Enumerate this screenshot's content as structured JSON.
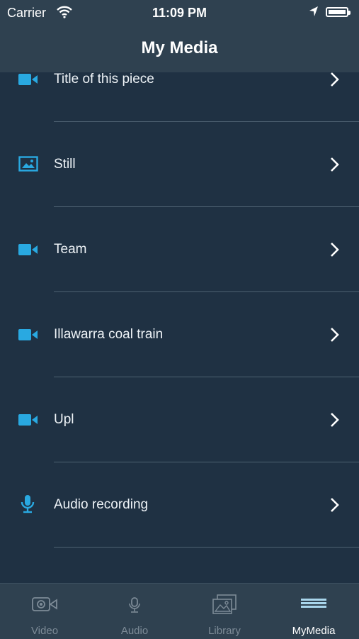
{
  "status": {
    "carrier": "Carrier",
    "time": "11:09 PM"
  },
  "nav": {
    "title": "My Media"
  },
  "items": [
    {
      "label": "Title of this piece",
      "type": "video"
    },
    {
      "label": "Still",
      "type": "image"
    },
    {
      "label": "Team",
      "type": "video"
    },
    {
      "label": "Illawarra coal train",
      "type": "video"
    },
    {
      "label": "Upl",
      "type": "video"
    },
    {
      "label": "Audio recording",
      "type": "audio"
    }
  ],
  "tabs": [
    {
      "label": "Video",
      "icon": "video-camera-icon",
      "active": false
    },
    {
      "label": "Audio",
      "icon": "microphone-icon",
      "active": false
    },
    {
      "label": "Library",
      "icon": "photo-library-icon",
      "active": false
    },
    {
      "label": "MyMedia",
      "icon": "stack-icon",
      "active": true
    }
  ],
  "colors": {
    "accent": "#29a9e1",
    "background": "#1f3143",
    "bar": "#2f4150"
  }
}
